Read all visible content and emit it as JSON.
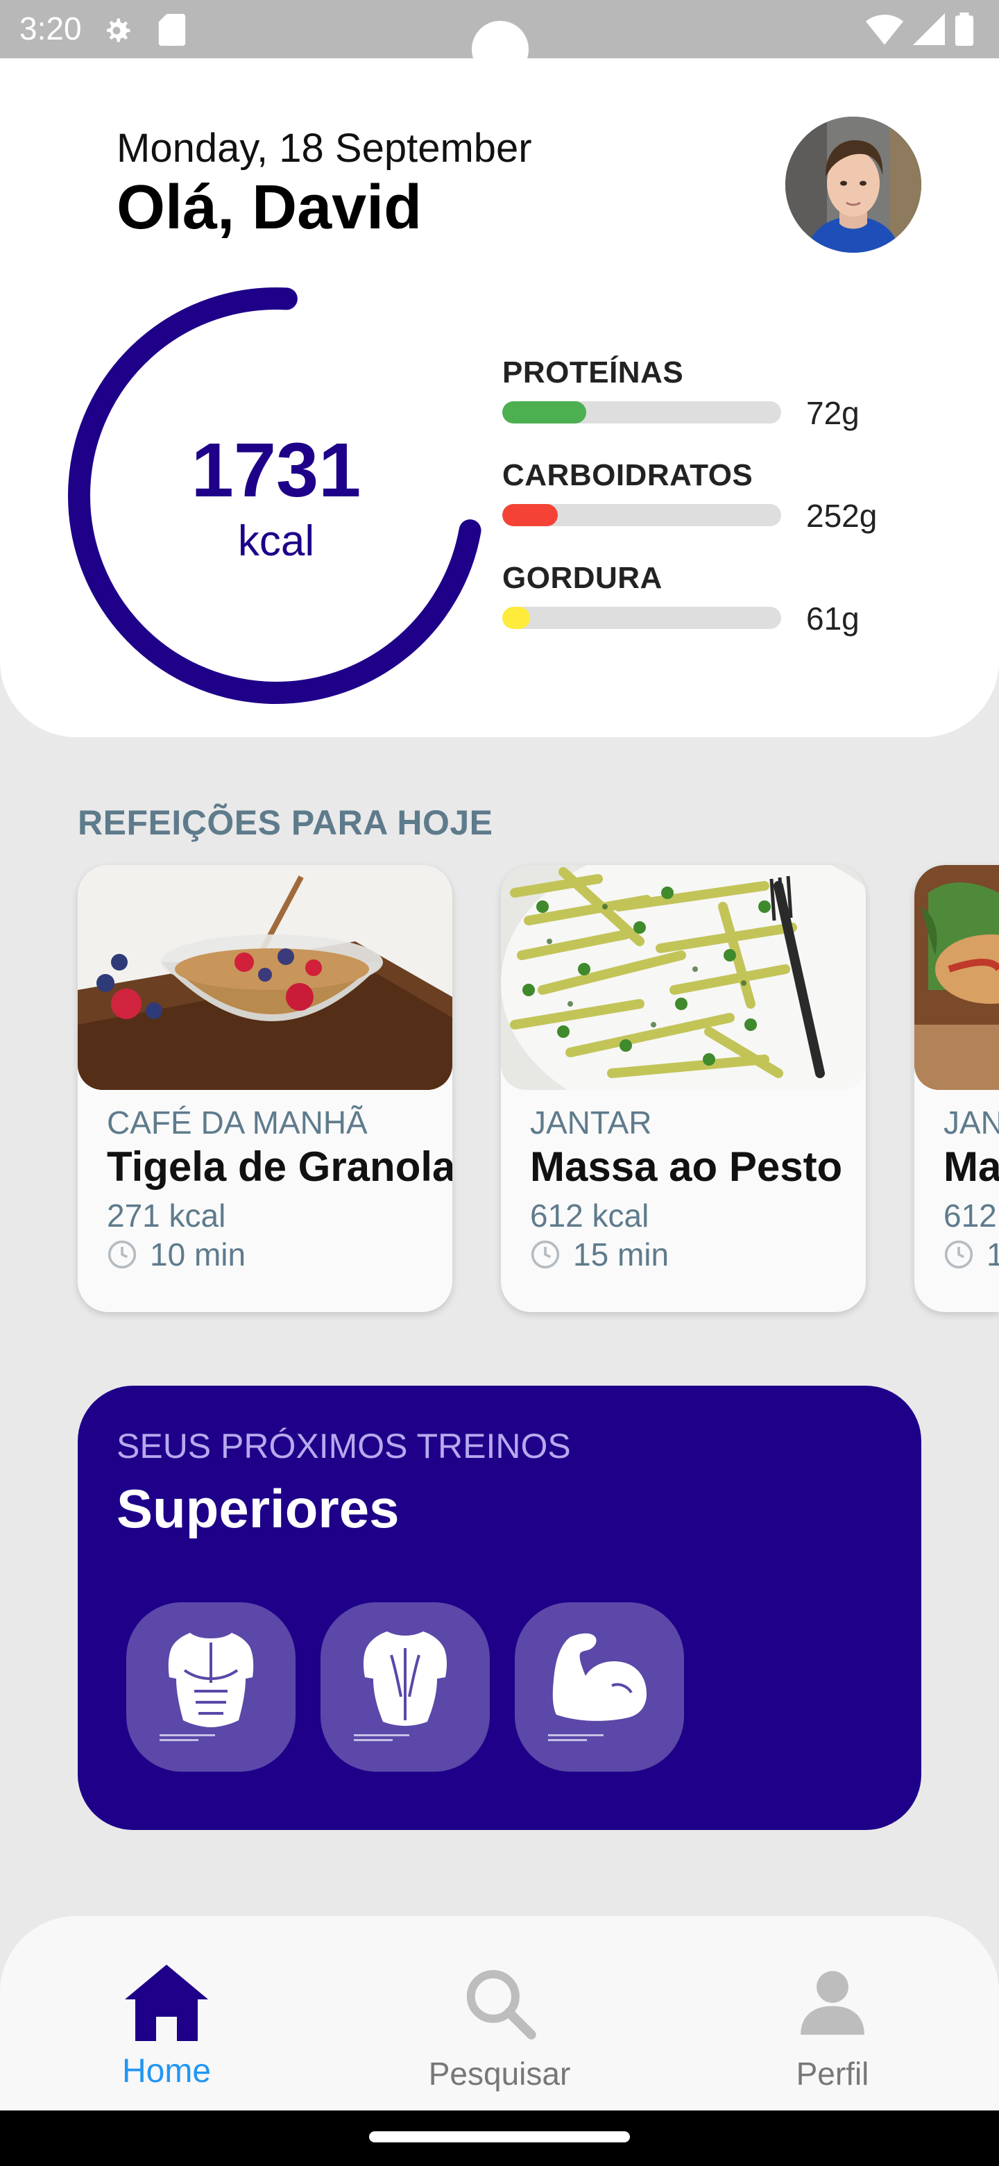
{
  "status_bar": {
    "time": "3:20"
  },
  "header": {
    "date": "Monday, 18 September",
    "greeting": "Olá, David"
  },
  "calories": {
    "value": "1731",
    "unit": "kcal",
    "progress": 0.73
  },
  "macros": [
    {
      "name": "PROTEÍNAS",
      "amount": "72g",
      "fill": 0.3,
      "color": "#4caf50"
    },
    {
      "name": "CARBOIDRATOS",
      "amount": "252g",
      "fill": 0.2,
      "color": "#f44336"
    },
    {
      "name": "GORDURA",
      "amount": "61g",
      "fill": 0.1,
      "color": "#ffeb3b"
    }
  ],
  "meals_section": {
    "title": "REFEIÇÕES PARA HOJE",
    "items": [
      {
        "type": "CAFÉ DA MANHÃ",
        "name": "Tigela de Granola",
        "kcal": "271 kcal",
        "time": "10 min"
      },
      {
        "type": "JANTAR",
        "name": "Massa ao Pesto",
        "kcal": "612 kcal",
        "time": "15 min"
      },
      {
        "type": "JAN",
        "name": "Ma",
        "kcal": "612",
        "time": "1"
      }
    ]
  },
  "workouts": {
    "label": "SEUS PRÓXIMOS TREINOS",
    "title": "Superiores",
    "icons": [
      "chest-icon",
      "back-icon",
      "biceps-icon"
    ]
  },
  "nav": {
    "home": "Home",
    "search": "Pesquisar",
    "profile": "Perfil"
  },
  "colors": {
    "primary": "#1e0089",
    "accent": "#2196f3",
    "muted": "#5e7b8c"
  }
}
